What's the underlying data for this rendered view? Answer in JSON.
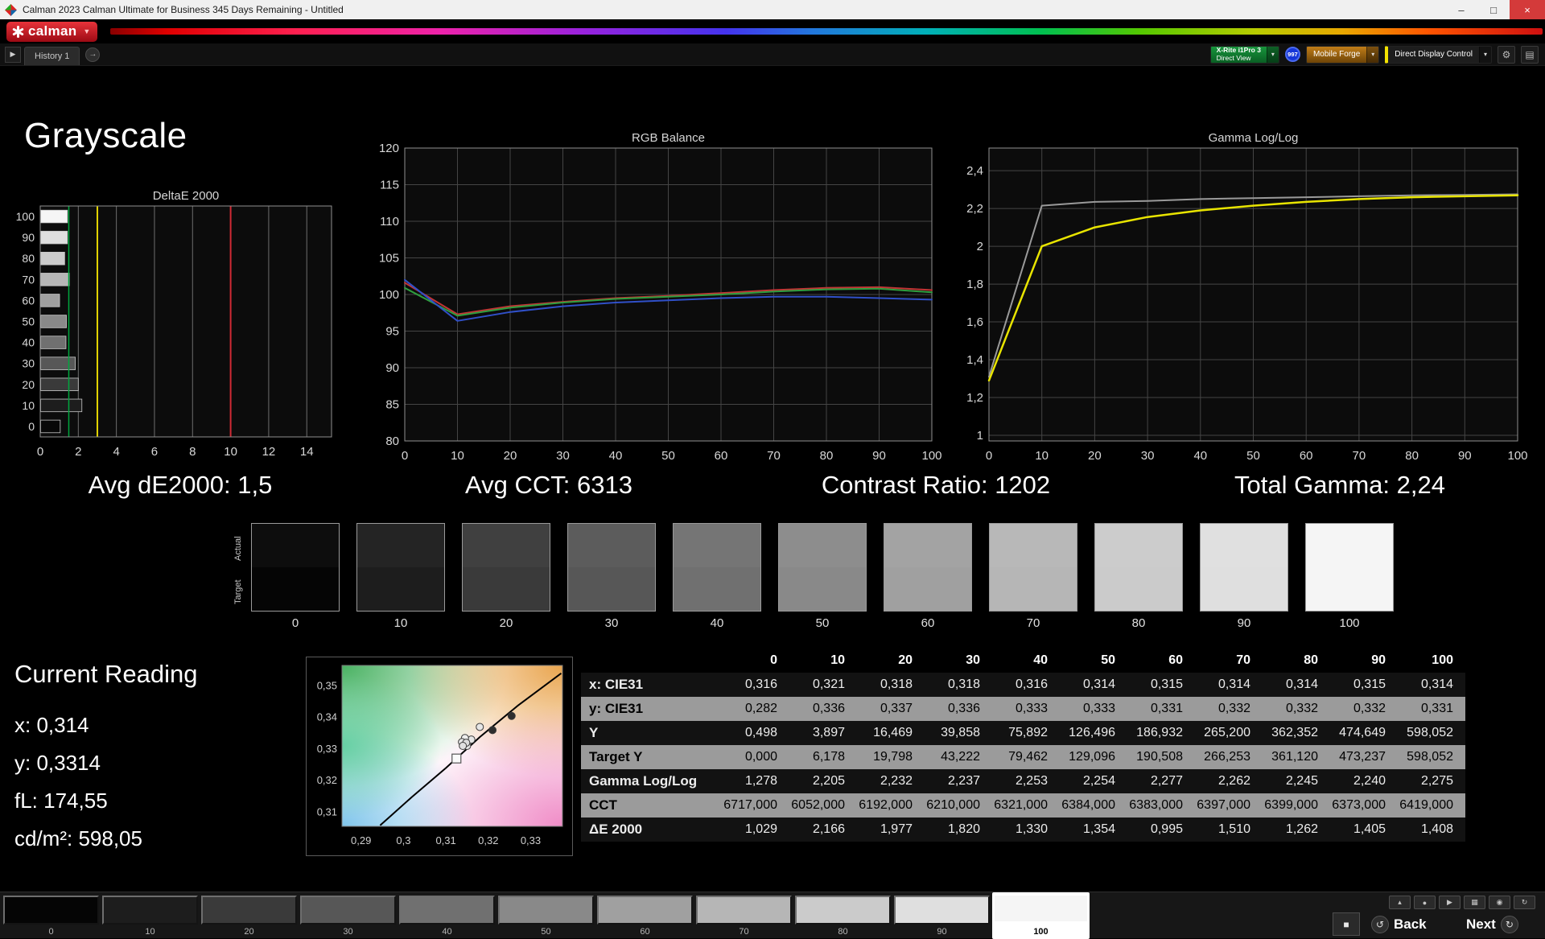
{
  "title_bar": {
    "title": "Calman 2023 Calman Ultimate for Business 345 Days Remaining  - Untitled",
    "minimize": "–",
    "maximize": "□",
    "close": "×"
  },
  "logo_bar": {
    "logo_text": "calman",
    "caret": "▼"
  },
  "history_bar": {
    "tab_label": "History 1",
    "expand_glyph": "▶",
    "forward_glyph": "→"
  },
  "meter_bar": {
    "meter_line1": "X-Rite i1Pro 3",
    "meter_line2": "Direct View",
    "badge": "997",
    "source_label": "Mobile Forge",
    "control_label": "Direct Display Control",
    "chevron": "▾",
    "gear_glyph": "⚙",
    "panel_glyph": "▤"
  },
  "page": {
    "heading": "Grayscale"
  },
  "stats": [
    "Avg dE2000: 1,5",
    "Avg CCT: 6313",
    "Contrast Ratio: 1202",
    "Total Gamma: 2,24"
  ],
  "swatch_strip": {
    "row_labels": [
      "Actual",
      "Target"
    ],
    "levels": [
      "0",
      "10",
      "20",
      "30",
      "40",
      "50",
      "60",
      "70",
      "80",
      "90",
      "100"
    ],
    "grays": [
      "#050505",
      "#1d1d1d",
      "#3a3a3a",
      "#575757",
      "#707070",
      "#898989",
      "#a0a0a0",
      "#b6b6b6",
      "#cbcbcb",
      "#dfdfdf",
      "#f5f5f5"
    ]
  },
  "current_reading": {
    "title": "Current Reading",
    "lines": [
      "x: 0,314",
      "y: 0,3314",
      "fL: 174,55",
      "cd/m²: 598,05"
    ]
  },
  "table": {
    "columns": [
      "0",
      "10",
      "20",
      "30",
      "40",
      "50",
      "60",
      "70",
      "80",
      "90",
      "100"
    ],
    "rows": [
      {
        "label": "x: CIE31",
        "values": [
          "0,316",
          "0,321",
          "0,318",
          "0,318",
          "0,316",
          "0,314",
          "0,315",
          "0,314",
          "0,314",
          "0,315",
          "0,314"
        ]
      },
      {
        "label": "y: CIE31",
        "values": [
          "0,282",
          "0,336",
          "0,337",
          "0,336",
          "0,333",
          "0,333",
          "0,331",
          "0,332",
          "0,332",
          "0,332",
          "0,331"
        ]
      },
      {
        "label": "Y",
        "values": [
          "0,498",
          "3,897",
          "16,469",
          "39,858",
          "75,892",
          "126,496",
          "186,932",
          "265,200",
          "362,352",
          "474,649",
          "598,052"
        ]
      },
      {
        "label": "Target Y",
        "values": [
          "0,000",
          "6,178",
          "19,798",
          "43,222",
          "79,462",
          "129,096",
          "190,508",
          "266,253",
          "361,120",
          "473,237",
          "598,052"
        ]
      },
      {
        "label": "Gamma Log/Log",
        "values": [
          "1,278",
          "2,205",
          "2,232",
          "2,237",
          "2,253",
          "2,254",
          "2,277",
          "2,262",
          "2,245",
          "2,240",
          "2,275"
        ]
      },
      {
        "label": "CCT",
        "values": [
          "6717,000",
          "6052,000",
          "6192,000",
          "6210,000",
          "6321,000",
          "6384,000",
          "6383,000",
          "6397,000",
          "6399,000",
          "6373,000",
          "6419,000"
        ]
      },
      {
        "label": "ΔE 2000",
        "values": [
          "1,029",
          "2,166",
          "1,977",
          "1,820",
          "1,330",
          "1,354",
          "0,995",
          "1,510",
          "1,262",
          "1,405",
          "1,408"
        ]
      }
    ]
  },
  "patch_bar": {
    "labels": [
      "0",
      "10",
      "20",
      "30",
      "40",
      "50",
      "60",
      "70",
      "80",
      "90",
      "100"
    ],
    "selected_index": 10
  },
  "transport": {
    "small_buttons": [
      {
        "name": "eject-icon",
        "glyph": "▴"
      },
      {
        "name": "record-icon",
        "glyph": "●"
      },
      {
        "name": "play-icon",
        "glyph": "▶"
      },
      {
        "name": "grid-icon",
        "glyph": "▦"
      },
      {
        "name": "target-icon",
        "glyph": "◉"
      },
      {
        "name": "refresh-icon",
        "glyph": "↻"
      }
    ],
    "stop_glyph": "■",
    "back_label": "Back",
    "back_glyph": "↺",
    "next_label": "Next",
    "next_glyph": "↻"
  },
  "chart_data": [
    {
      "name": "deltae-2000",
      "type": "bar",
      "orientation": "horizontal",
      "title": "DeltaE 2000",
      "categories": [
        "100",
        "90",
        "80",
        "70",
        "60",
        "50",
        "40",
        "30",
        "20",
        "10",
        "0"
      ],
      "values": [
        1.408,
        1.405,
        1.262,
        1.51,
        0.995,
        1.354,
        1.33,
        1.82,
        1.977,
        2.166,
        1.029
      ],
      "bar_colors": [
        "#f5f5f5",
        "#dfdfdf",
        "#cbcbcb",
        "#b6b6b6",
        "#a0a0a0",
        "#898989",
        "#707070",
        "#575757",
        "#3a3a3a",
        "#1d1d1d",
        "#080808"
      ],
      "xlim": [
        0,
        15.3
      ],
      "x_ticks": [
        0,
        2,
        4,
        6,
        8,
        10,
        12,
        14
      ],
      "reference_lines": [
        {
          "x": 1.5,
          "color": "#00a63e",
          "width": 1.5,
          "label": "avg-de-marker"
        },
        {
          "x": 3,
          "color": "#e3d400",
          "width": 2,
          "label": "warning-threshold"
        },
        {
          "x": 10,
          "color": "#d02a35",
          "width": 2,
          "label": "error-threshold"
        }
      ]
    },
    {
      "name": "rgb-balance",
      "type": "line",
      "title": "RGB Balance",
      "x": [
        0,
        10,
        20,
        30,
        40,
        50,
        60,
        70,
        80,
        90,
        100
      ],
      "xlim": [
        0,
        100
      ],
      "ylim": [
        80,
        120
      ],
      "x_ticks": [
        0,
        10,
        20,
        30,
        40,
        50,
        60,
        70,
        80,
        90,
        100
      ],
      "y_ticks": [
        80,
        85,
        90,
        95,
        100,
        105,
        110,
        115,
        120
      ],
      "series": [
        {
          "name": "red",
          "color": "#c23535",
          "width": 2,
          "values": [
            101.6,
            97.3,
            98.4,
            99.0,
            99.5,
            99.8,
            100.2,
            100.6,
            100.9,
            101.0,
            100.6
          ]
        },
        {
          "name": "green",
          "color": "#2f9e3f",
          "width": 2,
          "values": [
            100.9,
            97.1,
            98.2,
            98.9,
            99.4,
            99.7,
            100.0,
            100.4,
            100.7,
            100.8,
            100.3
          ]
        },
        {
          "name": "blue",
          "color": "#3050c8",
          "width": 2,
          "values": [
            102.0,
            96.4,
            97.6,
            98.4,
            98.9,
            99.2,
            99.5,
            99.7,
            99.7,
            99.5,
            99.3
          ]
        }
      ]
    },
    {
      "name": "gamma-log-log",
      "type": "line",
      "title": "Gamma Log/Log",
      "x": [
        0,
        10,
        20,
        30,
        40,
        50,
        60,
        70,
        80,
        90,
        100
      ],
      "xlim": [
        0,
        100
      ],
      "ylim": [
        0.97,
        2.52
      ],
      "x_ticks": [
        0,
        10,
        20,
        30,
        40,
        50,
        60,
        70,
        80,
        90,
        100
      ],
      "y_ticks": [
        1,
        1.2,
        1.4,
        1.6,
        1.8,
        2,
        2.2,
        2.4
      ],
      "y_tick_labels": [
        "1",
        "1,2",
        "1,4",
        "1,6",
        "1,8",
        "2",
        "2,2",
        "2,4"
      ],
      "series": [
        {
          "name": "reference",
          "color": "#9a9a9a",
          "width": 2,
          "values": [
            1.31,
            2.215,
            2.235,
            2.24,
            2.25,
            2.255,
            2.26,
            2.265,
            2.27,
            2.272,
            2.275
          ]
        },
        {
          "name": "measured",
          "color": "#e8e400",
          "width": 2.5,
          "values": [
            1.29,
            2.0,
            2.1,
            2.155,
            2.19,
            2.215,
            2.235,
            2.25,
            2.26,
            2.265,
            2.27
          ]
        }
      ]
    },
    {
      "name": "cie-1931-detail",
      "type": "scatter",
      "xlim": [
        0.2855,
        0.3375
      ],
      "ylim": [
        0.3055,
        0.3565
      ],
      "x_ticks": [
        0.29,
        0.3,
        0.31,
        0.32,
        0.33
      ],
      "x_tick_labels": [
        "0,29",
        "0,3",
        "0,31",
        "0,32",
        "0,33"
      ],
      "y_ticks": [
        0.31,
        0.32,
        0.33,
        0.34,
        0.35
      ],
      "y_tick_labels": [
        "0,31",
        "0,32",
        "0,33",
        "0,34",
        "0,35"
      ],
      "gradient": [
        {
          "cx": "0%",
          "cy": "0%",
          "r": "75%",
          "color": "#3fae5a"
        },
        {
          "cx": "100%",
          "cy": "0%",
          "r": "70%",
          "color": "#e8a045"
        },
        {
          "cx": "100%",
          "cy": "100%",
          "r": "75%",
          "color": "#ef86c4"
        },
        {
          "cx": "0%",
          "cy": "100%",
          "r": "60%",
          "color": "#79c2ea"
        },
        {
          "cx": "0%",
          "cy": "50%",
          "r": "45%",
          "color": "#62cfa2"
        }
      ],
      "locus": [
        [
          0.2945,
          0.3058
        ],
        [
          0.302,
          0.3148
        ],
        [
          0.31,
          0.324
        ],
        [
          0.318,
          0.3338
        ],
        [
          0.327,
          0.3438
        ],
        [
          0.3372,
          0.354
        ]
      ],
      "target_marker": {
        "x": 0.3125,
        "y": 0.327
      },
      "points": [
        {
          "x": 0.321,
          "y": 0.336,
          "fill": "#2e2e2e"
        },
        {
          "x": 0.3255,
          "y": 0.3405,
          "fill": "#2e2e2e"
        },
        {
          "x": 0.318,
          "y": 0.337,
          "fill": "#e6e6e6"
        },
        {
          "x": 0.316,
          "y": 0.333,
          "fill": "#e6e6e6"
        },
        {
          "x": 0.3145,
          "y": 0.3335,
          "fill": "#ededed"
        },
        {
          "x": 0.315,
          "y": 0.331,
          "fill": "#e0e0e0"
        },
        {
          "x": 0.314,
          "y": 0.332,
          "fill": "#d8d8d8"
        },
        {
          "x": 0.3138,
          "y": 0.3322,
          "fill": "#e6e6e6"
        },
        {
          "x": 0.3148,
          "y": 0.332,
          "fill": "#dcdcdc"
        },
        {
          "x": 0.314,
          "y": 0.331,
          "fill": "#e0e0e0"
        }
      ]
    }
  ]
}
